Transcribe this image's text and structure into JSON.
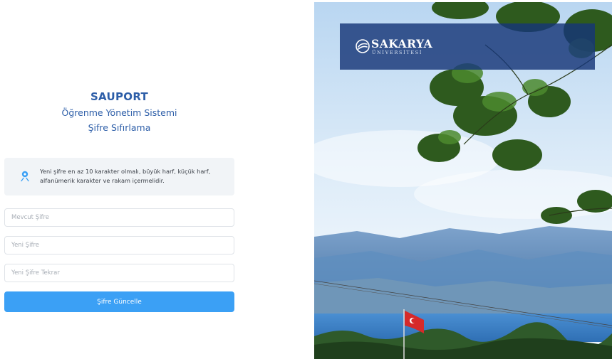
{
  "heading": {
    "title": "SAUPORT",
    "subtitle": "Öğrenme Yönetim Sistemi",
    "page_name": "Şifre Sıfırlama"
  },
  "info": {
    "icon": "location-pin-icon",
    "text": "Yeni şifre en az 10 karakter olmalı, büyük harf, küçük harf, alfanümerik karakter ve rakam içermelidir."
  },
  "form": {
    "current_password": {
      "placeholder": "Mevcut Şifre",
      "value": ""
    },
    "new_password": {
      "placeholder": "Yeni Şifre",
      "value": ""
    },
    "new_password_repeat": {
      "placeholder": "Yeni Şifre Tekrar",
      "value": ""
    },
    "submit_label": "Şifre Güncelle"
  },
  "brand": {
    "logo_main": "SAKARYA",
    "logo_sub": "ÜNİVERSİTESİ"
  },
  "colors": {
    "heading": "#2d5ea8",
    "button": "#3ba0f5",
    "info_bg": "#f1f4f7",
    "logo_band": "#163678"
  }
}
